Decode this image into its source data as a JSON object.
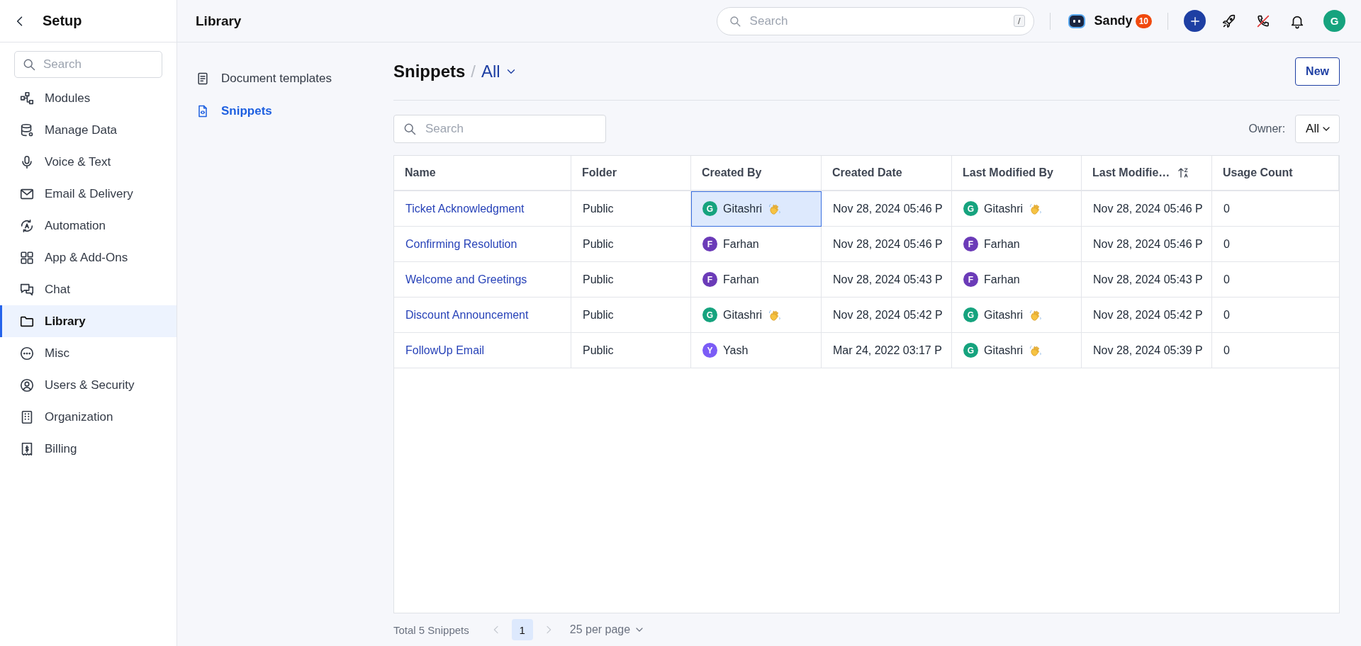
{
  "sidebar": {
    "title": "Setup",
    "search": {
      "placeholder": "Search"
    },
    "items": [
      {
        "label": "Modules",
        "selected": false
      },
      {
        "label": "Manage Data",
        "selected": false
      },
      {
        "label": "Voice & Text",
        "selected": false
      },
      {
        "label": "Email & Delivery",
        "selected": false
      },
      {
        "label": "Automation",
        "selected": false
      },
      {
        "label": "App & Add-Ons",
        "selected": false
      },
      {
        "label": "Chat",
        "selected": false
      },
      {
        "label": "Library",
        "selected": true
      },
      {
        "label": "Misc",
        "selected": false
      },
      {
        "label": "Users & Security",
        "selected": false
      },
      {
        "label": "Organization",
        "selected": false
      },
      {
        "label": "Billing",
        "selected": false
      }
    ]
  },
  "topbar": {
    "title": "Library",
    "search": {
      "placeholder": "Search",
      "shortcut": "/"
    },
    "assistant": {
      "name": "Sandy",
      "badge": "10"
    },
    "avatar": "G"
  },
  "subnav": {
    "items": [
      {
        "label": "Document templates",
        "selected": false
      },
      {
        "label": "Snippets",
        "selected": true
      }
    ]
  },
  "header": {
    "title": "Snippets",
    "separator": "/",
    "view": "All",
    "new_button": "New"
  },
  "filters": {
    "search": {
      "placeholder": "Search"
    },
    "owner_label": "Owner:",
    "owner_value": "All"
  },
  "table": {
    "columns": [
      {
        "label": "Name",
        "sorted": false
      },
      {
        "label": "Folder",
        "sorted": false
      },
      {
        "label": "Created By",
        "sorted": false
      },
      {
        "label": "Created Date",
        "sorted": false
      },
      {
        "label": "Last Modified By",
        "sorted": false
      },
      {
        "label": "Last Modifie…",
        "sorted": true
      },
      {
        "label": "Usage Count",
        "sorted": false
      }
    ],
    "rows": [
      {
        "name": "Ticket Acknowledgment",
        "folder": "Public",
        "created_by": {
          "initial": "G",
          "name": "Gitashri",
          "color": "#16a37e",
          "wave": true,
          "selected": true
        },
        "created_date": "Nov 28, 2024 05:46 P",
        "modified_by": {
          "initial": "G",
          "name": "Gitashri",
          "color": "#16a37e",
          "wave": true
        },
        "modified_date": "Nov 28, 2024 05:46 P",
        "usage": "0"
      },
      {
        "name": "Confirming Resolution",
        "folder": "Public",
        "created_by": {
          "initial": "F",
          "name": "Farhan",
          "color": "#6b3bb8",
          "wave": false,
          "selected": false
        },
        "created_date": "Nov 28, 2024 05:46 P",
        "modified_by": {
          "initial": "F",
          "name": "Farhan",
          "color": "#6b3bb8",
          "wave": false
        },
        "modified_date": "Nov 28, 2024 05:46 P",
        "usage": "0"
      },
      {
        "name": "Welcome and Greetings",
        "folder": "Public",
        "created_by": {
          "initial": "F",
          "name": "Farhan",
          "color": "#6b3bb8",
          "wave": false,
          "selected": false
        },
        "created_date": "Nov 28, 2024 05:43 P",
        "modified_by": {
          "initial": "F",
          "name": "Farhan",
          "color": "#6b3bb8",
          "wave": false
        },
        "modified_date": "Nov 28, 2024 05:43 P",
        "usage": "0"
      },
      {
        "name": "Discount Announcement",
        "folder": "Public",
        "created_by": {
          "initial": "G",
          "name": "Gitashri",
          "color": "#16a37e",
          "wave": true,
          "selected": false
        },
        "created_date": "Nov 28, 2024 05:42 P",
        "modified_by": {
          "initial": "G",
          "name": "Gitashri",
          "color": "#16a37e",
          "wave": true
        },
        "modified_date": "Nov 28, 2024 05:42 P",
        "usage": "0"
      },
      {
        "name": "FollowUp Email",
        "folder": "Public",
        "created_by": {
          "initial": "Y",
          "name": "Yash",
          "color": "#7b5cf6",
          "wave": false,
          "selected": false
        },
        "created_date": "Mar 24, 2022 03:17 P",
        "modified_by": {
          "initial": "G",
          "name": "Gitashri",
          "color": "#16a37e",
          "wave": true
        },
        "modified_date": "Nov 28, 2024 05:39 P",
        "usage": "0"
      }
    ]
  },
  "pagination": {
    "total": "Total 5 Snippets",
    "prev_disabled": true,
    "pages": [
      {
        "label": "1",
        "selected": true
      }
    ],
    "next_disabled": true,
    "page_size": "25 per page"
  }
}
